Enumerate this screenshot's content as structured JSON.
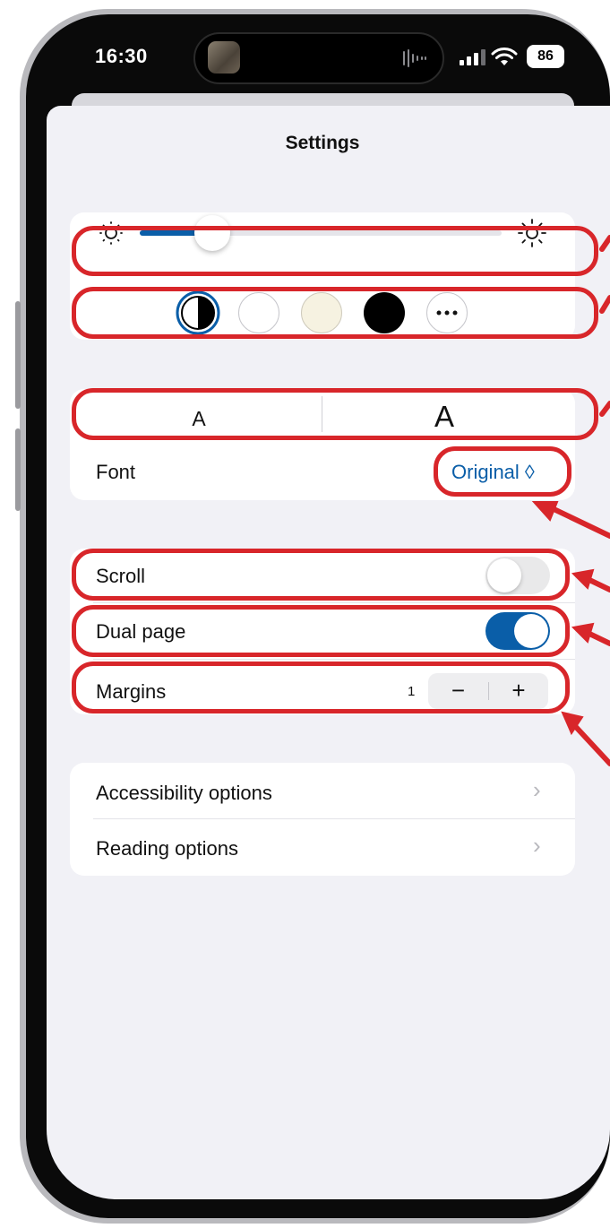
{
  "status_bar": {
    "time": "16:30",
    "battery": "86"
  },
  "header": {
    "title": "Settings"
  },
  "appearance": {
    "brightness_level": 0.2,
    "themes": [
      "auto-theme",
      "white-theme",
      "sepia-theme",
      "black-theme",
      "more-themes"
    ],
    "font_size_small": "A",
    "font_size_large": "A",
    "font_label": "Font",
    "font_value": "Original ◊"
  },
  "layout": {
    "scroll_label": "Scroll",
    "scroll_on": false,
    "dual_page_label": "Dual page",
    "dual_page_on": true,
    "margins_label": "Margins",
    "margins_value": "1",
    "decrease": "−",
    "increase": "+"
  },
  "more_options": {
    "accessibility_label": "Accessibility options",
    "reading_label": "Reading options"
  },
  "colors": {
    "accent": "#0a5ea8",
    "highlight": "#d8262a",
    "background": "#f1f1f6"
  }
}
